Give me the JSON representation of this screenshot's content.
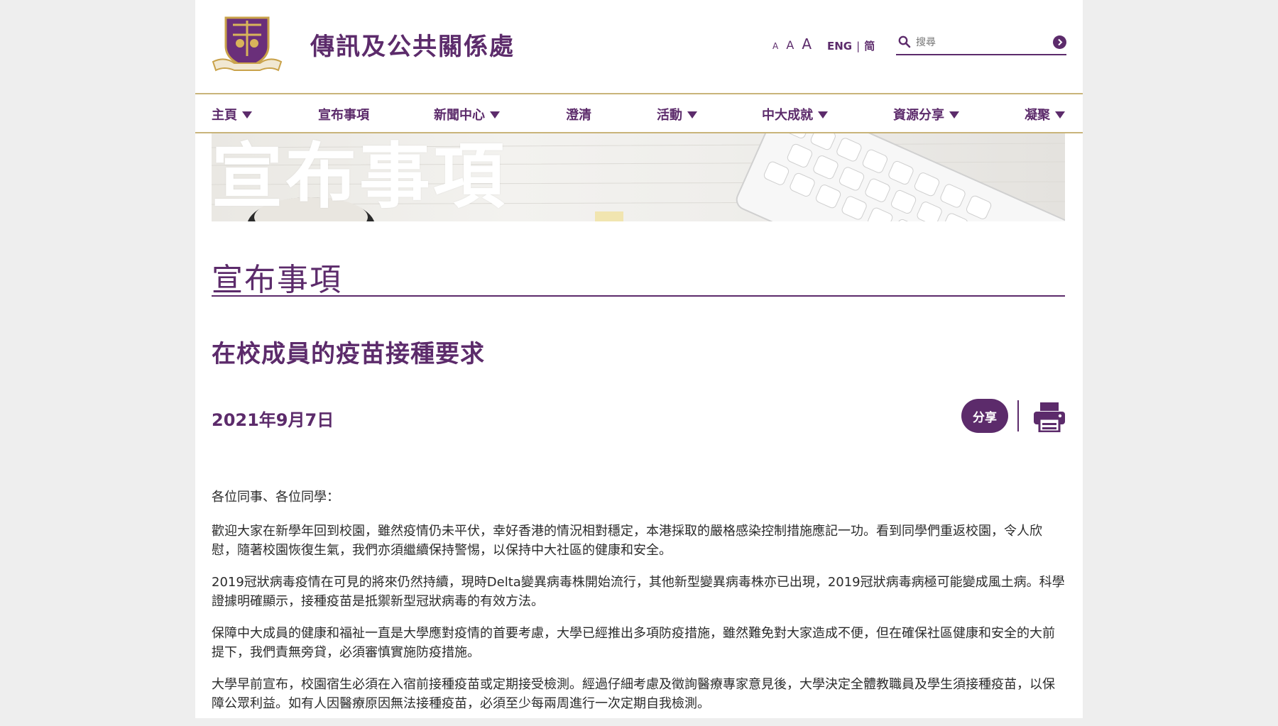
{
  "header": {
    "site_title": "傳訊及公共關係處",
    "font_sizes": [
      "A",
      "A",
      "A"
    ],
    "lang_eng": "ENG",
    "lang_separator": "|",
    "lang_simplified": "简",
    "search_placeholder": "搜尋"
  },
  "nav": {
    "items": [
      {
        "label": "主頁",
        "dropdown": true
      },
      {
        "label": "宣布事項",
        "dropdown": false
      },
      {
        "label": "新聞中心",
        "dropdown": true
      },
      {
        "label": "澄清",
        "dropdown": false
      },
      {
        "label": "活動",
        "dropdown": true
      },
      {
        "label": "中大成就",
        "dropdown": true
      },
      {
        "label": "資源分享",
        "dropdown": true
      },
      {
        "label": "凝聚",
        "dropdown": true
      }
    ]
  },
  "banner": {
    "title": "宣布事項"
  },
  "main": {
    "section_heading": "宣布事項",
    "article_title": "在校成員的疫苗接種要求",
    "date": "2021年9月7日",
    "share_label": "分享",
    "paragraphs": [
      "各位同事、各位同學：",
      "歡迎大家在新學年回到校園，雖然疫情仍未平伏，幸好香港的情況相對穩定，本港採取的嚴格感染控制措施應記一功。看到同學們重返校園，令人欣慰，隨著校園恢復生氣，我們亦須繼續保持警惕，以保持中大社區的健康和安全。",
      "2019冠狀病毒疫情在可見的將來仍然持續，現時Delta變異病毒株開始流行，其他新型變異病毒株亦已出現，2019冠狀病毒病極可能變成風土病。科學證據明確顯示，接種疫苗是抵禦新型冠狀病毒的有效方法。",
      "保障中大成員的健康和福祉一直是大學應對疫情的首要考慮，大學已經推出多項防疫措施，雖然難免對大家造成不便，但在確保社區健康和安全的大前提下，我們責無旁貸，必須審慎實施防疫措施。",
      "大學早前宣布，校園宿生必須在入宿前接種疫苗或定期接受檢測。經過仔細考慮及徵詢醫療專家意見後，大學決定全體教職員及學生須接種疫苗，以保障公眾利益。如有人因醫療原因無法接種疫苗，必須至少每兩周進行一次定期自我檢測。"
    ]
  },
  "colors": {
    "brand_purple": "#5c2b6b",
    "gold_rule": "#c9b47a"
  },
  "icons": [
    "university-crest-icon",
    "search-icon",
    "search-go-icon",
    "caret-down-icon",
    "print-icon"
  ]
}
